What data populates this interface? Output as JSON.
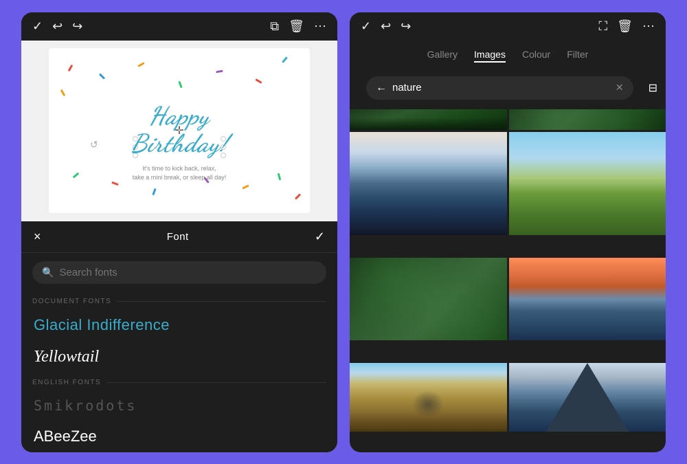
{
  "leftPanel": {
    "toolbar": {
      "check_icon": "✓",
      "undo_icon": "↩",
      "redo_icon": "↪",
      "copy_icon": "⧉",
      "delete_icon": "🗑",
      "more_icon": "⋯"
    },
    "card": {
      "title_line1": "Happy",
      "title_line2": "Birthday!",
      "subtitle": "It's time to kick back, relax,\ntake a mini break, or sleep all day!"
    },
    "fontPanel": {
      "close_label": "×",
      "title": "Font",
      "check_label": "✓",
      "search_placeholder": "Search fonts",
      "document_fonts_label": "DOCUMENT FONTS",
      "english_fonts_label": "ENGLISH FONTS",
      "fonts": [
        {
          "name": "Glacial Indifference",
          "style": "glacial"
        },
        {
          "name": "Yellowtail",
          "style": "yellowtail"
        },
        {
          "name": "Smikrodots",
          "style": "smikrodots"
        },
        {
          "name": "ABeeZee",
          "style": "abee"
        }
      ]
    }
  },
  "rightPanel": {
    "toolbar": {
      "check_icon": "✓",
      "undo_icon": "↩",
      "redo_icon": "↪",
      "crop_icon": "⛶",
      "delete_icon": "🗑",
      "more_icon": "⋯"
    },
    "tabs": [
      {
        "label": "Gallery",
        "active": false
      },
      {
        "label": "Images",
        "active": true
      },
      {
        "label": "Colour",
        "active": false
      },
      {
        "label": "Filter",
        "active": false
      }
    ],
    "search": {
      "value": "nature",
      "placeholder": "nature"
    },
    "images": [
      {
        "type": "forest",
        "alt": "Aerial forest view"
      },
      {
        "type": "leaves",
        "alt": "Green leaves closeup"
      },
      {
        "type": "mountain",
        "alt": "Mountain lake reflection"
      },
      {
        "type": "meadow",
        "alt": "Green meadow with clouds"
      },
      {
        "type": "clover",
        "alt": "Dark green clovers"
      },
      {
        "type": "river",
        "alt": "River at sunset"
      },
      {
        "type": "autumn",
        "alt": "Autumn field with person"
      },
      {
        "type": "volcano",
        "alt": "Volcano mountain"
      }
    ]
  }
}
